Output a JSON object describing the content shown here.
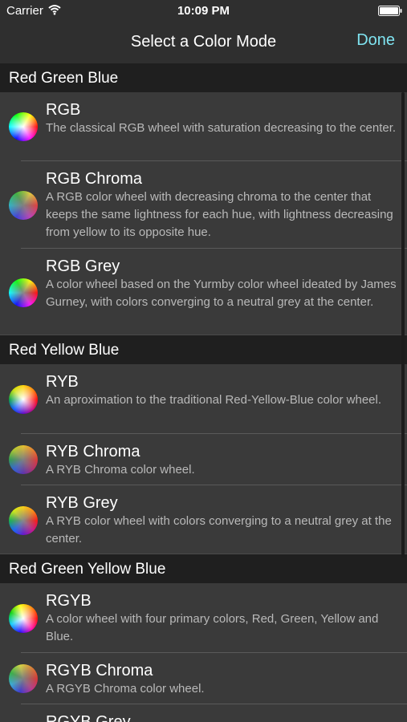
{
  "status_bar": {
    "carrier": "Carrier",
    "time": "10:09 PM",
    "wifi_icon": "wifi-icon",
    "battery_icon": "battery-icon"
  },
  "nav_bar": {
    "title": "Select a Color Mode",
    "done_label": "Done",
    "done_color": "#7fe3f0"
  },
  "sections": [
    {
      "header": "Red Green Blue",
      "rows": [
        {
          "title": "RGB",
          "description": "The classical RGB wheel with saturation decreasing to the center.",
          "icon": "rgb-wheel-icon"
        },
        {
          "title": "RGB Chroma",
          "description": "A RGB color wheel with decreasing chroma to the center that keeps the same lightness for each hue, with lightness decreasing from yellow to its opposite hue.",
          "icon": "rgb-chroma-wheel-icon"
        },
        {
          "title": "RGB Grey",
          "description": "A color wheel based on the Yurmby color wheel ideated by James Gurney, with colors converging to a neutral grey at the center.",
          "icon": "rgb-grey-wheel-icon"
        }
      ]
    },
    {
      "header": "Red Yellow Blue",
      "rows": [
        {
          "title": "RYB",
          "description": "An aproximation to the traditional Red-Yellow-Blue color wheel.",
          "icon": "ryb-wheel-icon"
        },
        {
          "title": "RYB Chroma",
          "description": "A RYB Chroma color wheel.",
          "icon": "ryb-chroma-wheel-icon"
        },
        {
          "title": "RYB Grey",
          "description": "A RYB color wheel with colors converging to a neutral grey at the center.",
          "icon": "ryb-grey-wheel-icon"
        }
      ]
    },
    {
      "header": "Red Green Yellow Blue",
      "rows": [
        {
          "title": "RGYB",
          "description": "A color wheel with four primary colors, Red, Green, Yellow and Blue.",
          "icon": "rgyb-wheel-icon"
        },
        {
          "title": "RGYB Chroma",
          "description": "A RGYB Chroma color wheel.",
          "icon": "rgyb-chroma-wheel-icon"
        },
        {
          "title": "RGYB Grey",
          "description": "",
          "icon": "rgyb-grey-wheel-icon"
        }
      ]
    }
  ]
}
